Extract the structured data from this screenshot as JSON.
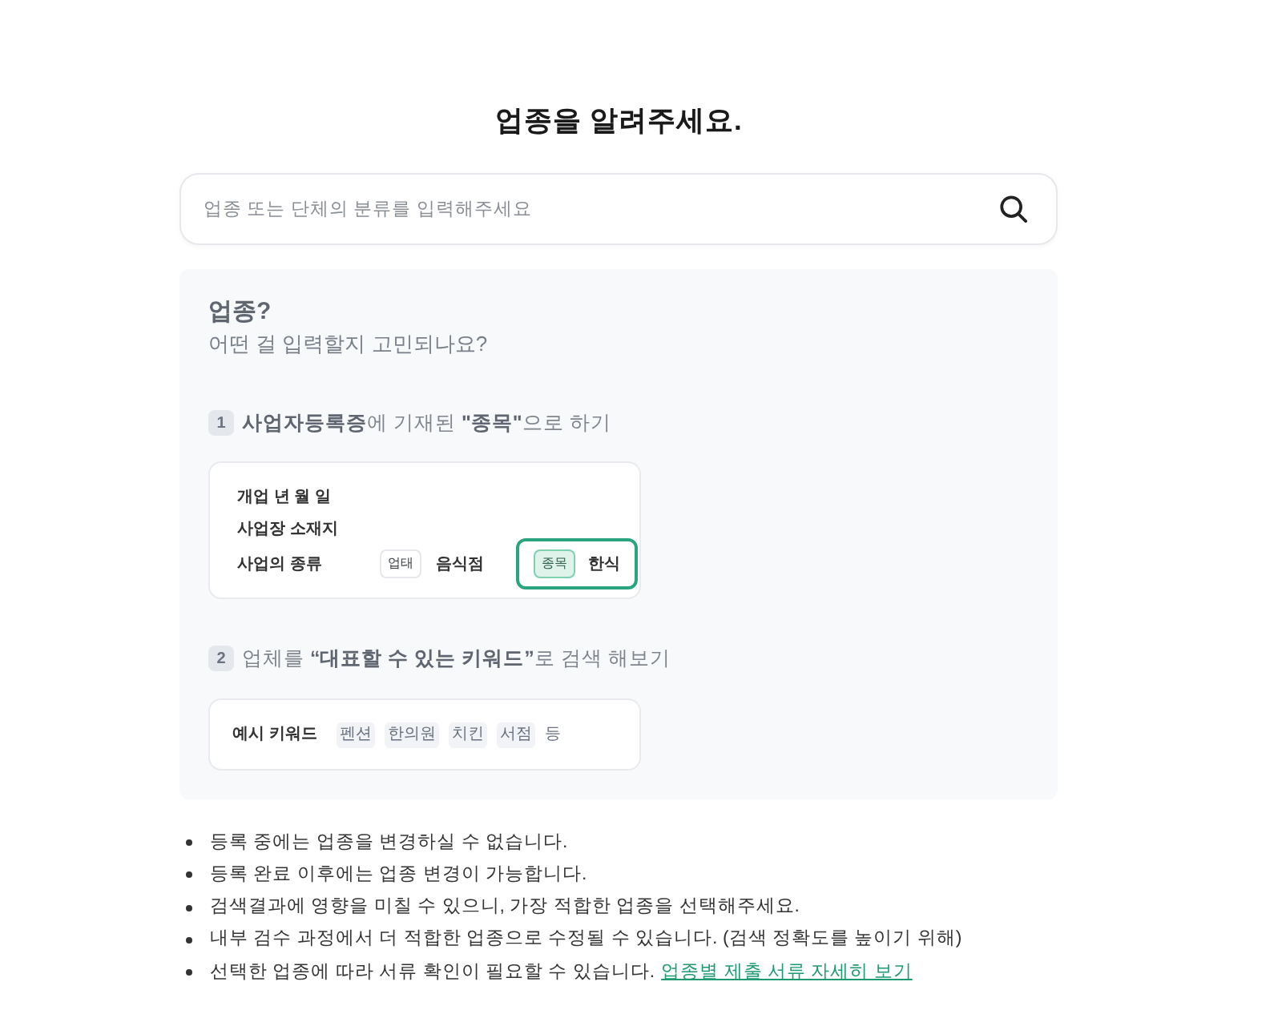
{
  "title": "업종을 알려주세요.",
  "search": {
    "placeholder": "업종 또는 단체의 분류를 입력해주세요"
  },
  "help_panel": {
    "heading": "업종?",
    "subheading": "어떤 걸 입력할지 고민되나요?",
    "steps": [
      {
        "number": "1",
        "text": "**사업자등록증**에 기재된 **\"종목\"**으로 하기",
        "kind": "certificate",
        "rows": [
          {
            "label": "개업 년 월 일",
            "fields": []
          },
          {
            "label": "사업장 소재지",
            "fields": []
          },
          {
            "label": "사업의 종류",
            "fields": [
              {
                "tag": "업태",
                "value": "음식점",
                "highlighted": false
              },
              {
                "tag": "종목",
                "value": "한식",
                "highlighted": true
              }
            ]
          }
        ]
      },
      {
        "number": "2",
        "text": "업체를 **“대표할 수 있는 키워드”**로 검색 해보기",
        "kind": "keywords",
        "label": "예시 키워드",
        "chips": [
          "펜션",
          "한의원",
          "치킨",
          "서점"
        ],
        "suffix": "등"
      }
    ]
  },
  "notes": [
    {
      "text": "등록 중에는 업종을 변경하실 수 없습니다."
    },
    {
      "text": "등록 완료 이후에는 업종 변경이 가능합니다."
    },
    {
      "text": "검색결과에 영향을 미칠 수 있으니, 가장 적합한 업종을 선택해주세요."
    },
    {
      "text": "내부 검수 과정에서 더 적합한 업종으로 수정될 수 있습니다. (검색 정확도를 높이기 위해)"
    },
    {
      "text": "선택한 업종에 따라 서류 확인이 필요할 수 있습니다.",
      "link": "업종별 제출 서류 자세히 보기"
    }
  ]
}
